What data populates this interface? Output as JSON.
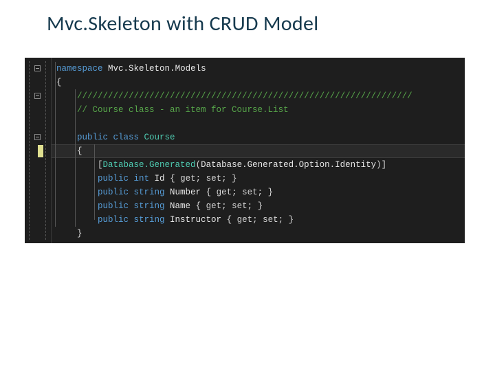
{
  "title": "Mvc.Skeleton with CRUD Model",
  "code": {
    "l1_kw": "namespace",
    "l1_ns1": " Mvc.",
    "l1_ns2": "Skeleton",
    "l1_ns3": ".",
    "l1_ns4": "Models",
    "brace_open": "{",
    "brace_close": "}",
    "slash_line": "/////////////////////////////////////////////////////////////////",
    "comment": "// Course class - an item for Course.List",
    "l5_public": "public",
    "l5_class": " class ",
    "l5_name": "Course",
    "attr_open": "[",
    "attr_dg": "Database.Generated",
    "attr_paren_open": "(",
    "attr_dgo": "Database.Generated.Option",
    "attr_dot": ".",
    "attr_id": "Identity",
    "attr_paren_close": ")",
    "attr_close": "]",
    "p_public": "public",
    "p_int": " int ",
    "p_string": " string ",
    "p_id": "Id",
    "p_number": "Number",
    "p_name": "Name",
    "p_instructor": "Instructor",
    "accessor": " { get; set; }"
  }
}
